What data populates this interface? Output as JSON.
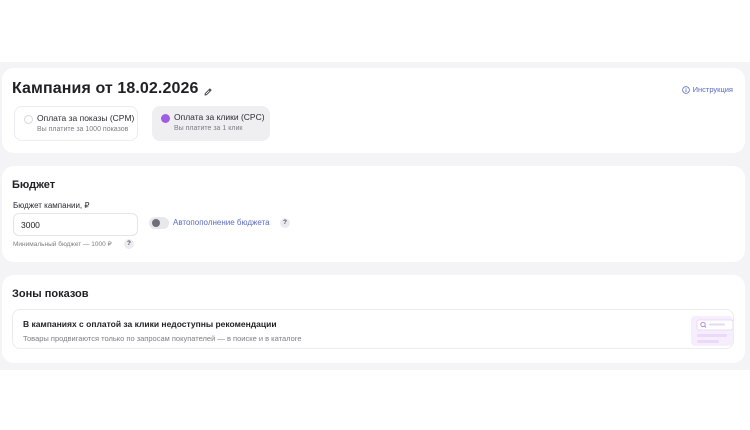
{
  "campaign": {
    "title": "Кампания от 18.02.2026",
    "instruction_label": "Инструкция",
    "payment_options": [
      {
        "title": "Оплата за показы (CPM)",
        "subtitle": "Вы платите за 1000 показов",
        "selected": false
      },
      {
        "title": "Оплата за клики (CPC)",
        "subtitle": "Вы платите за 1 клик",
        "selected": true
      }
    ]
  },
  "budget": {
    "heading": "Бюджет",
    "field_label": "Бюджет кампании, ₽",
    "value": "3000",
    "autofill_label": "Автопополнение бюджета",
    "autofill_enabled": false,
    "help_symbol": "?",
    "min_note": "Минимальный бюджет — 1000 ₽"
  },
  "zones": {
    "heading": "Зоны показов",
    "notice_title": "В кампаниях с оплатой за клики недоступны рекомендации",
    "notice_text": "Товары продвигаются только по запросам покупателей — в поиске и в каталоге"
  },
  "colors": {
    "accent_purple": "#a15ce6",
    "link_blue": "#5b6ac2",
    "page_bg": "#f4f4f6"
  },
  "icons": {
    "edit": "pencil-icon",
    "info": "info-icon",
    "illustration": "search-results-illustration-icon"
  }
}
